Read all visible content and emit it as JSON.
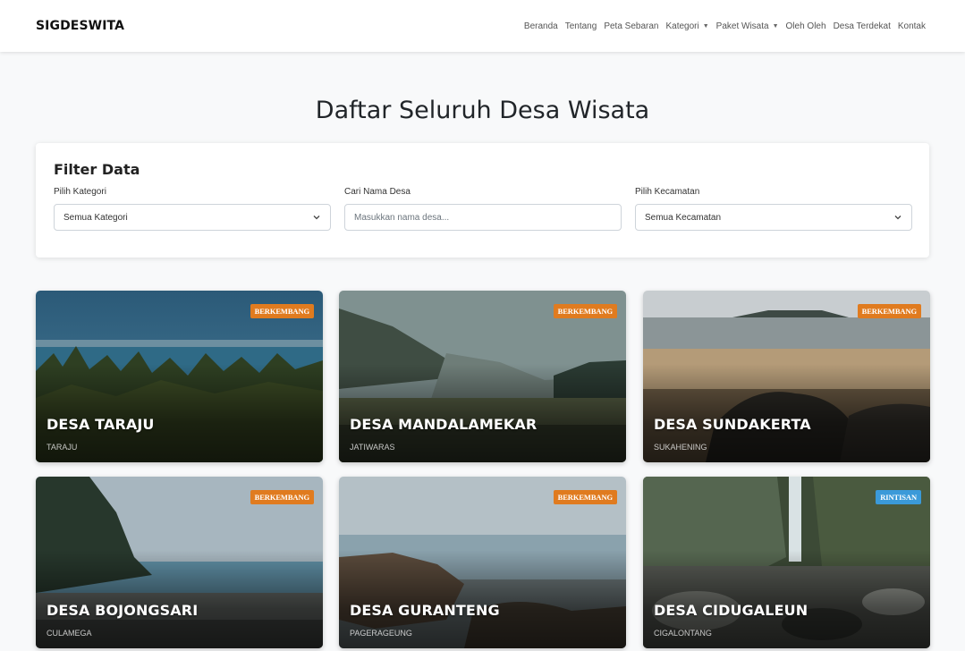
{
  "navbar": {
    "brand": "SIGDESWITA",
    "links": [
      {
        "label": "Beranda"
      },
      {
        "label": "Tentang"
      },
      {
        "label": "Peta Sebaran"
      },
      {
        "label": "Kategori"
      },
      {
        "label": "Paket Wisata"
      },
      {
        "label": "Oleh Oleh"
      },
      {
        "label": "Desa Terdekat"
      },
      {
        "label": "Kontak"
      }
    ]
  },
  "page": {
    "title": "Daftar Seluruh Desa Wisata"
  },
  "filter": {
    "title": "Filter Data",
    "kategori": {
      "label": "Pilih Kategori",
      "value": "Semua Kategori"
    },
    "search": {
      "label": "Cari Nama Desa",
      "placeholder": "Masukkan nama desa..."
    },
    "kecamatan": {
      "label": "Pilih Kecamatan",
      "value": "Semua Kecamatan"
    }
  },
  "cards": [
    {
      "name": "DESA TARAJU",
      "district": "TARAJU",
      "status": "BERKEMBANG",
      "status_color": "#e07b1f"
    },
    {
      "name": "DESA MANDALAMEKAR",
      "district": "JATIWARAS",
      "status": "BERKEMBANG",
      "status_color": "#e07b1f"
    },
    {
      "name": "DESA SUNDAKERTA",
      "district": "SUKAHENING",
      "status": "BERKEMBANG",
      "status_color": "#e07b1f"
    },
    {
      "name": "DESA BOJONGSARI",
      "district": "CULAMEGA",
      "status": "BERKEMBANG",
      "status_color": "#e07b1f"
    },
    {
      "name": "DESA GURANTENG",
      "district": "PAGERAGEUNG",
      "status": "BERKEMBANG",
      "status_color": "#e07b1f"
    },
    {
      "name": "DESA CIDUGALEUN",
      "district": "CIGALONTANG",
      "status": "RINTISAN",
      "status_color": "#3b9ad9"
    }
  ]
}
